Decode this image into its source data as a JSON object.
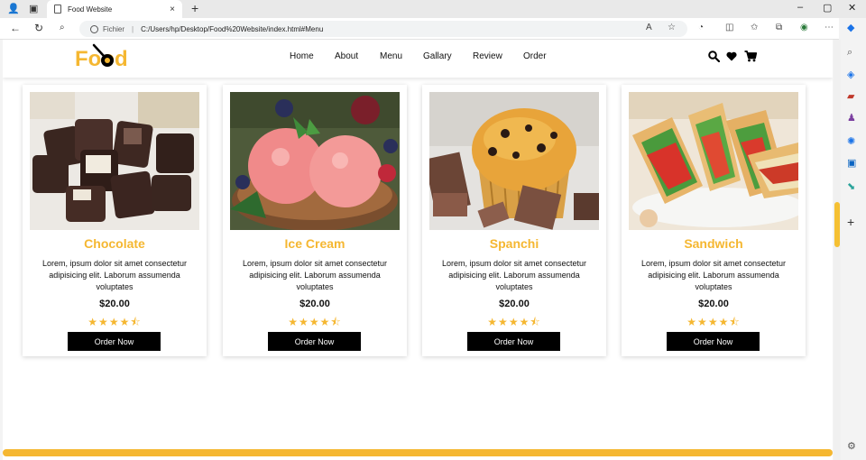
{
  "browser": {
    "tab_title": "Food Website",
    "tab_close": "×",
    "new_tab": "+",
    "address_prefix": "Fichier",
    "address_sep": "|",
    "url": "C:/Users/hp/Desktop/Food%20Website/index.html#Menu",
    "window_controls": [
      "–",
      "▢",
      "✕"
    ]
  },
  "site": {
    "logo_text": "Food",
    "nav": [
      "Home",
      "About",
      "Menu",
      "Gallary",
      "Review",
      "Order"
    ]
  },
  "menu": {
    "items": [
      {
        "name": "Chocolate",
        "desc": "Lorem, ipsum dolor sit amet consectetur adipisicing elit. Laborum assumenda voluptates",
        "price": "$20.00",
        "rating": 4.5,
        "button": "Order Now",
        "photo": "chocolate"
      },
      {
        "name": "Ice Cream",
        "desc": "Lorem, ipsum dolor sit amet consectetur adipisicing elit. Laborum assumenda voluptates",
        "price": "$20.00",
        "rating": 4.5,
        "button": "Order Now",
        "photo": "ice-cream"
      },
      {
        "name": "Spanchi",
        "desc": "Lorem, ipsum dolor sit amet consectetur adipisicing elit. Laborum assumenda voluptates",
        "price": "$20.00",
        "rating": 4.5,
        "button": "Order Now",
        "photo": "muffin"
      },
      {
        "name": "Sandwich",
        "desc": "Lorem, ipsum dolor sit amet consectetur adipisicing elit. Laborum assumenda voluptates",
        "price": "$20.00",
        "rating": 4.5,
        "button": "Order Now",
        "photo": "sandwich"
      }
    ]
  },
  "colors": {
    "accent": "#f5b731",
    "button_bg": "#000000",
    "button_text": "#ffffff"
  }
}
